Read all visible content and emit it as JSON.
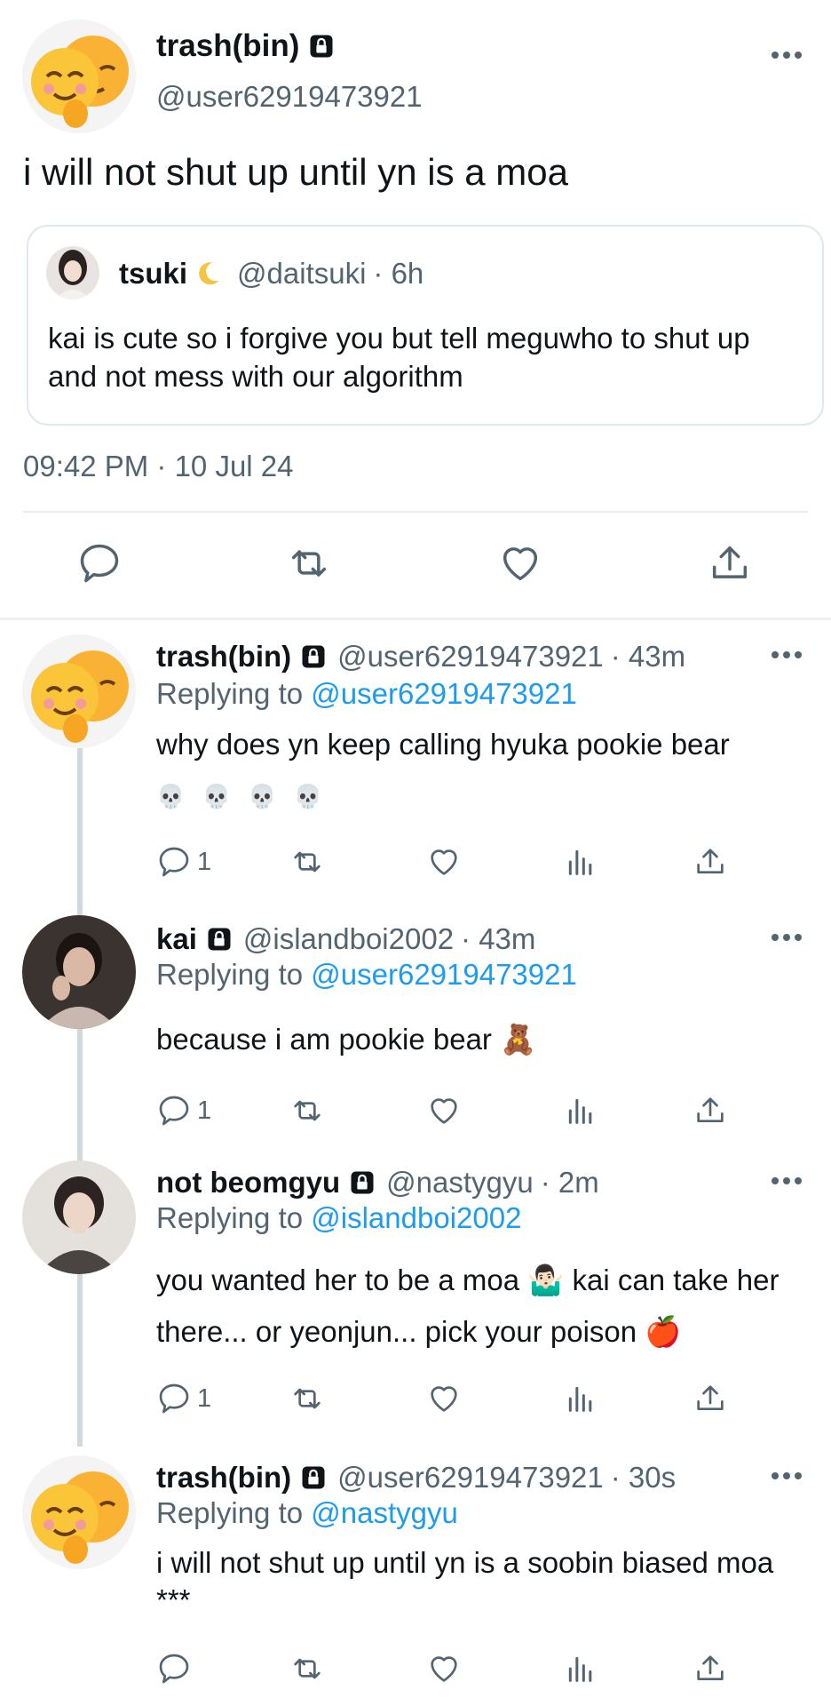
{
  "main_tweet": {
    "display_name": "trash(bin)",
    "handle": "@user62919473921",
    "text": "i will not shut up until yn is a moa",
    "quote": {
      "name": "tsuki",
      "handle": "@daitsuki",
      "time": "· 6h",
      "text": "kai is cute so i forgive you but tell meguwho to shut up and not mess with our algorithm"
    },
    "timestamp": "09:42 PM · 10 Jul 24"
  },
  "replies": [
    {
      "name": "trash(bin)",
      "handle": "@user62919473921",
      "time": "· 43m",
      "replying_prefix": "Replying to ",
      "replying_to": "@user62919473921",
      "text": "why does yn keep calling hyuka pookie bear",
      "trailing_emoji": "💀 💀 💀 💀",
      "reply_count": "1"
    },
    {
      "name": "kai",
      "handle": "@islandboi2002",
      "time": "· 43m",
      "replying_prefix": "Replying to ",
      "replying_to": "@user62919473921",
      "text": "because i am pookie bear 🧸",
      "reply_count": "1"
    },
    {
      "name": "not beomgyu",
      "handle": "@nastygyu",
      "time": "· 2m",
      "replying_prefix": "Replying to ",
      "replying_to": "@islandboi2002",
      "text": "you wanted her to be a moa 🤷🏻‍♂️ kai can take her there... or yeonjun... pick your poison 🍎",
      "reply_count": "1"
    },
    {
      "name": "trash(bin)",
      "handle": "@user62919473921",
      "time": "· 30s",
      "replying_prefix": "Replying to ",
      "replying_to": "@nastygyu",
      "text": "i will not shut up until yn is a soobin biased moa ***"
    }
  ],
  "colors": {
    "link": "#1d9bf0",
    "secondary_text": "#536471",
    "thread_line": "#cfd9de",
    "divider": "#e6ecf0"
  },
  "icons": [
    "lock-icon",
    "more-icon",
    "reply-icon",
    "retweet-icon",
    "like-icon",
    "share-icon",
    "views-icon"
  ]
}
